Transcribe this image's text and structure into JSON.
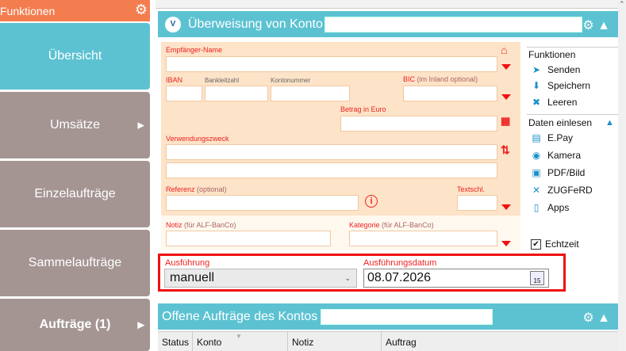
{
  "sidebar": {
    "header": "Funktionen",
    "items": [
      {
        "label": "Übersicht"
      },
      {
        "label": "Umsätze"
      },
      {
        "label": "Einzelaufträge"
      },
      {
        "label": "Sammelaufträge"
      },
      {
        "label": "Aufträge (1)"
      }
    ]
  },
  "transfer": {
    "title": "Überweisung von Konto",
    "fields": {
      "recipient": "Empfänger-Name",
      "iban": "IBAN",
      "bank_code": "Bankleitzahl",
      "account_number": "Kontonummer",
      "bic": "BIC",
      "bic_hint": "(im Inland optional)",
      "amount": "Betrag in Euro",
      "purpose": "Verwendungszweck",
      "reference": "Referenz",
      "reference_hint": "(optional)",
      "text_key": "Textschl.",
      "note": "Notiz",
      "note_hint": "(für ALF-BanCo)",
      "category": "Kategorie",
      "category_hint": "(für ALF-BanCo)"
    }
  },
  "functions": {
    "title": "Funktionen",
    "actions": [
      {
        "label": "Senden",
        "icon": "send-icon"
      },
      {
        "label": "Speichern",
        "icon": "download-icon"
      },
      {
        "label": "Leeren",
        "icon": "clear-icon"
      }
    ],
    "import_title": "Daten einlesen",
    "imports": [
      {
        "label": "E.Pay",
        "icon": "epay-icon"
      },
      {
        "label": "Kamera",
        "icon": "camera-icon"
      },
      {
        "label": "PDF/Bild",
        "icon": "pdf-icon"
      },
      {
        "label": "ZUGFeRD",
        "icon": "zugferd-icon"
      },
      {
        "label": "Apps",
        "icon": "apps-icon"
      }
    ],
    "realtime": "Echtzeit"
  },
  "execution": {
    "label": "Ausführung",
    "value": "manuell",
    "date_label": "Ausführungsdatum",
    "date_value": "08.07.2026",
    "calendar_day": "15"
  },
  "open_orders": {
    "title": "Offene Aufträge des Kontos",
    "columns": [
      "Status",
      "Konto",
      "Notiz",
      "Auftrag"
    ]
  },
  "colors": {
    "accent": "#5cc2d2",
    "sidebar_active": "#5cc2d2",
    "sidebar_item": "#a49593",
    "header": "#f47d4f",
    "form_bg": "#fde3c8",
    "highlight": "#ee1111"
  }
}
